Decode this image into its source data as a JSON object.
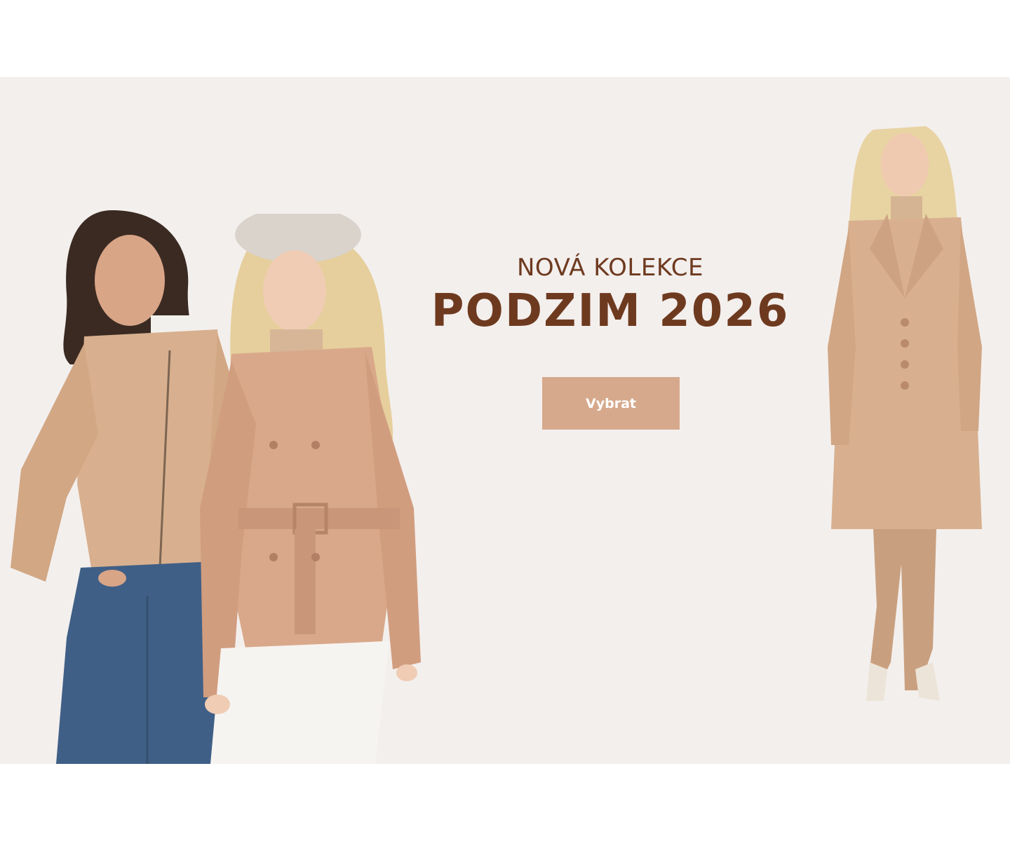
{
  "banner": {
    "eyebrow": "NOVÁ KOLEKCE",
    "title": "PODZIM 2026",
    "cta_label": "Vybrat"
  },
  "colors": {
    "banner_background": "#f3efed",
    "headline_brown": "#6e3a1f",
    "cta_background": "#d6a98c",
    "cta_text": "#ffffff",
    "leather_tan": "#d8b08f",
    "denim_blue": "#3f5f86"
  },
  "models": [
    {
      "name": "model-brunette-zip-jacket-jeans"
    },
    {
      "name": "model-blonde-beret-trench-jacket"
    },
    {
      "name": "model-blonde-long-leather-coat"
    }
  ]
}
